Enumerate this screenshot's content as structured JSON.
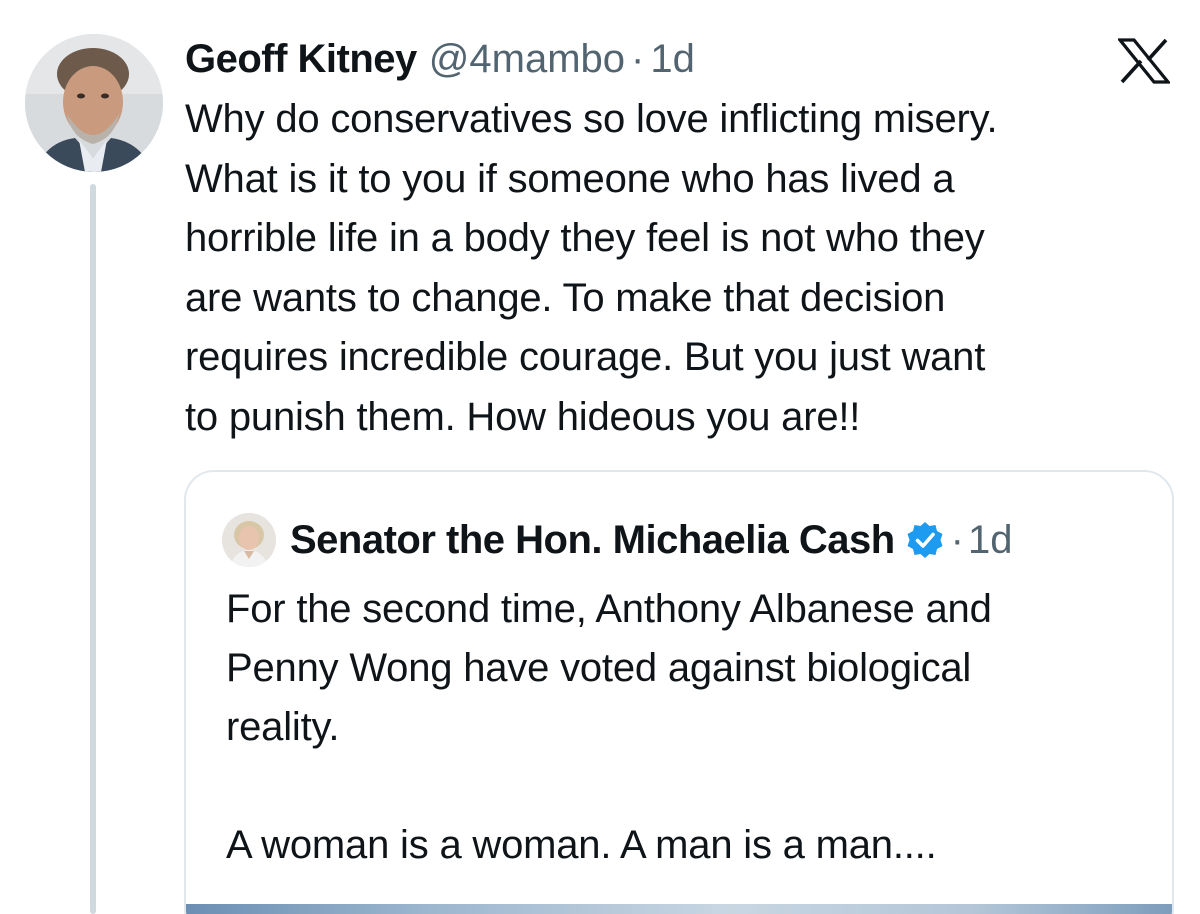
{
  "tweet": {
    "author_name": "Geoff Kitney",
    "handle": "@4mambo",
    "separator": "·",
    "time": "1d",
    "text": "Why do conservatives so love inflicting misery.\nWhat is it to you if someone who has lived a\nhorrible life in a body they feel is not who they\nare wants to change. To make that decision\nrequires incredible courage. But you just want\nto punish them. How hideous you are!!",
    "avatar_icon": "person-photo",
    "logo_icon": "x-logo-icon"
  },
  "quote": {
    "author_name": "Senator the Hon. Michaelia Cash",
    "verified": true,
    "verified_color": "#1d9bf0",
    "separator": "·",
    "time": "1d",
    "text": "For the second time, Anthony Albanese and\nPenny Wong have voted against biological\nreality.\n\nA woman is a woman. A man is a man....",
    "avatar_icon": "person-photo"
  },
  "colors": {
    "text_primary": "#0f1419",
    "text_secondary": "#536471",
    "border": "#e1e8ed",
    "thread_line": "#cfd9de"
  }
}
